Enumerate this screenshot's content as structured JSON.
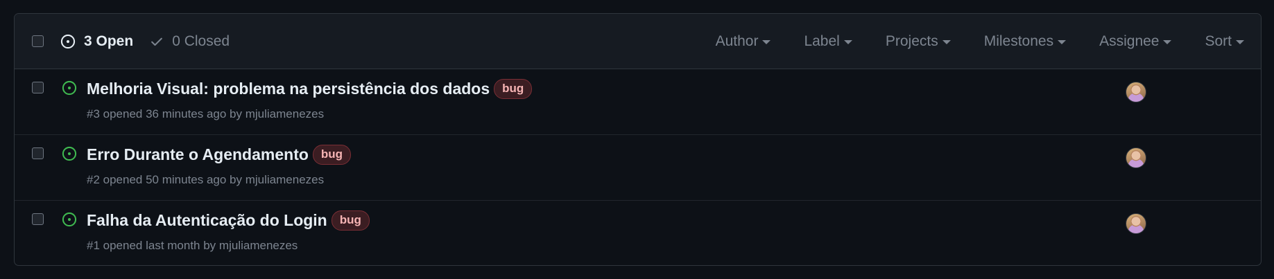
{
  "header": {
    "open_label": "3 Open",
    "closed_label": "0 Closed",
    "filters": [
      "Author",
      "Label",
      "Projects",
      "Milestones",
      "Assignee",
      "Sort"
    ]
  },
  "issues": [
    {
      "title": "Melhoria Visual: problema na persistência dos dados",
      "label": "bug",
      "meta": "#3 opened 36 minutes ago by ",
      "author": "mjuliamenezes"
    },
    {
      "title": "Erro Durante o Agendamento",
      "label": "bug",
      "meta": "#2 opened 50 minutes ago by ",
      "author": "mjuliamenezes"
    },
    {
      "title": "Falha da Autenticação do Login",
      "label": "bug",
      "meta": "#1 opened last month by ",
      "author": "mjuliamenezes"
    }
  ],
  "icons": {
    "open": "issue-opened-icon",
    "closed": "check-icon"
  },
  "colors": {
    "open_state": "#3fb950",
    "label_bug_bg": "#3b1d22",
    "label_bug_text": "#f6b4b4"
  }
}
